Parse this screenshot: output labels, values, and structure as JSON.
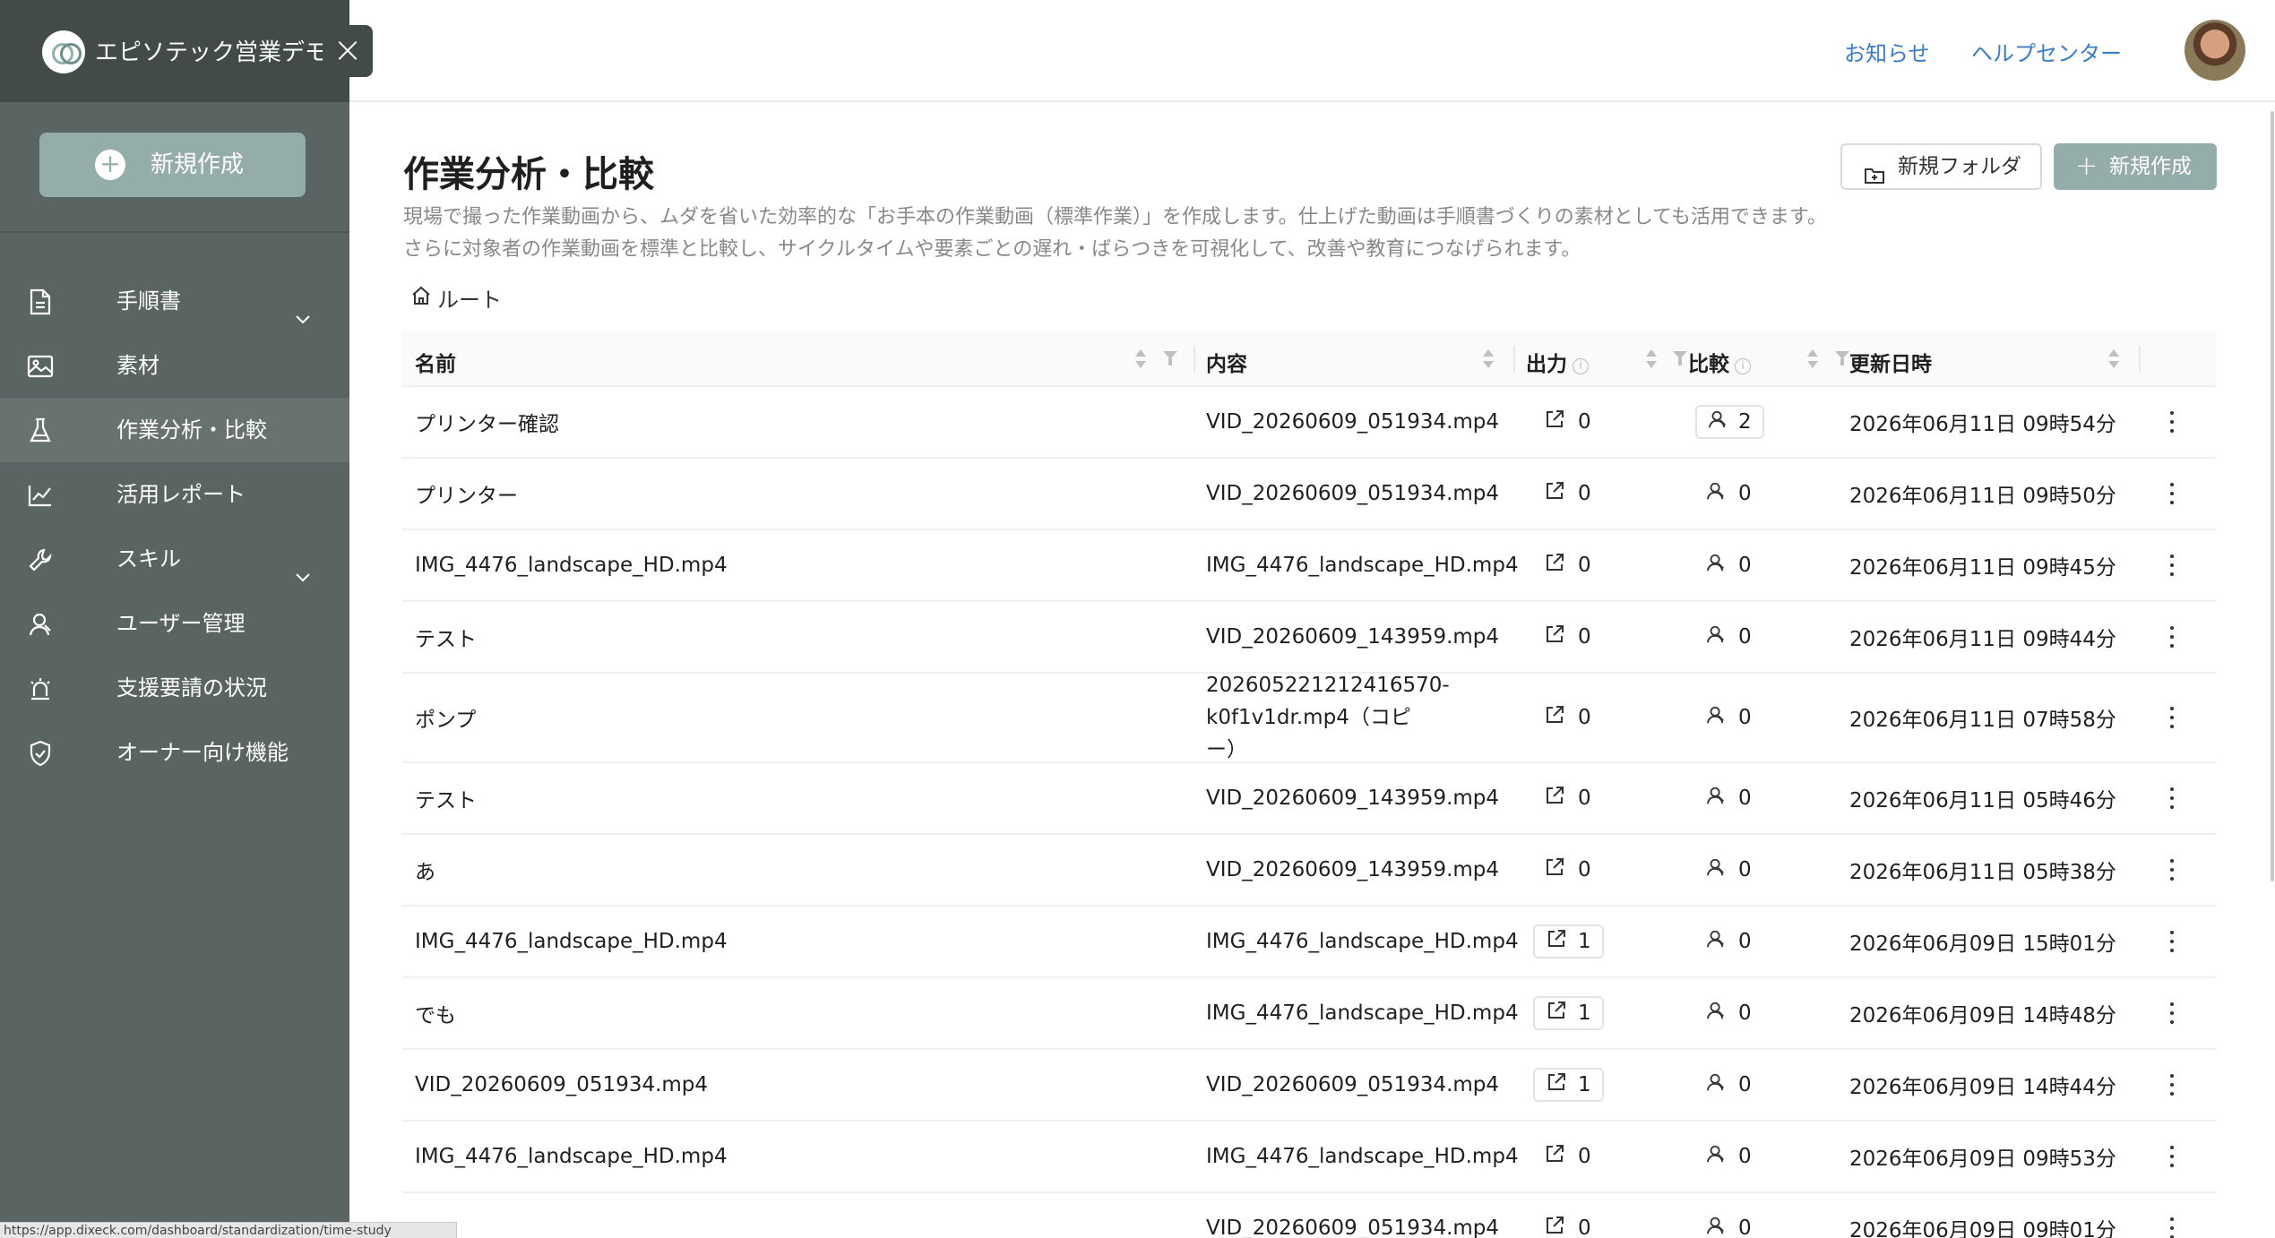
{
  "sidebar": {
    "org_name": "エピソテック営業デモ",
    "new_button": "新規作成",
    "items": [
      {
        "label": "手順書",
        "icon": "document-icon",
        "expandable": true
      },
      {
        "label": "素材",
        "icon": "image-icon"
      },
      {
        "label": "作業分析・比較",
        "icon": "flask-icon",
        "active": true
      },
      {
        "label": "活用レポート",
        "icon": "line-chart-icon"
      },
      {
        "label": "スキル",
        "icon": "wrench-icon",
        "expandable": true
      },
      {
        "label": "ユーザー管理",
        "icon": "user-icon"
      },
      {
        "label": "支援要請の状況",
        "icon": "alarm-icon"
      },
      {
        "label": "オーナー向け機能",
        "icon": "shield-check-icon"
      }
    ]
  },
  "topbar": {
    "notice_link": "お知らせ",
    "help_link": "ヘルプセンター"
  },
  "page": {
    "title": "作業分析・比較",
    "desc1": "現場で撮った作業動画から、ムダを省いた効率的な「お手本の作業動画（標準作業）」を作成します。仕上げた動画は手順書づくりの素材としても活用できます。",
    "desc2": "さらに対象者の作業動画を標準と比較し、サイクルタイムや要素ごとの遅れ・ばらつきを可視化して、改善や教育につなげられます。",
    "new_folder": "新規フォルダ",
    "new_create": "新規作成",
    "breadcrumb_root": "ルート"
  },
  "table": {
    "headers": {
      "name": "名前",
      "content": "内容",
      "output": "出力",
      "compare": "比較",
      "updated": "更新日時"
    },
    "rows": [
      {
        "name": "プリンター確認",
        "content": "VID_20260609_051934.mp4",
        "output": "0",
        "compare": "2",
        "updated": "2026年06月11日 09時54分"
      },
      {
        "name": "プリンター",
        "content": "VID_20260609_051934.mp4",
        "output": "0",
        "compare": "0",
        "updated": "2026年06月11日 09時50分"
      },
      {
        "name": "IMG_4476_landscape_HD.mp4",
        "content": "IMG_4476_landscape_HD.mp4",
        "output": "0",
        "compare": "0",
        "updated": "2026年06月11日 09時45分"
      },
      {
        "name": "テスト",
        "content": "VID_20260609_143959.mp4",
        "output": "0",
        "compare": "0",
        "updated": "2026年06月11日 09時44分"
      },
      {
        "name": "ポンプ",
        "content": "202605221212416570-k0f1v1dr.mp4（コピー）",
        "output": "0",
        "compare": "0",
        "updated": "2026年06月11日 07時58分"
      },
      {
        "name": "テスト",
        "content": "VID_20260609_143959.mp4",
        "output": "0",
        "compare": "0",
        "updated": "2026年06月11日 05時46分"
      },
      {
        "name": "あ",
        "content": "VID_20260609_143959.mp4",
        "output": "0",
        "compare": "0",
        "updated": "2026年06月11日 05時38分"
      },
      {
        "name": "IMG_4476_landscape_HD.mp4",
        "content": "IMG_4476_landscape_HD.mp4",
        "output": "1",
        "compare": "0",
        "updated": "2026年06月09日 15時01分"
      },
      {
        "name": "でも",
        "content": "IMG_4476_landscape_HD.mp4",
        "output": "1",
        "compare": "0",
        "updated": "2026年06月09日 14時48分"
      },
      {
        "name": "VID_20260609_051934.mp4",
        "content": "VID_20260609_051934.mp4",
        "output": "1",
        "compare": "0",
        "updated": "2026年06月09日 14時44分"
      },
      {
        "name": "IMG_4476_landscape_HD.mp4",
        "content": "IMG_4476_landscape_HD.mp4",
        "output": "0",
        "compare": "0",
        "updated": "2026年06月09日 09時53分"
      },
      {
        "name": "",
        "content": "VID_20260609_051934.mp4",
        "output": "0",
        "compare": "0",
        "updated": "2026年06月09日 09時01分"
      }
    ]
  },
  "status_bar": "https://app.dixeck.com/dashboard/standardization/time-study"
}
